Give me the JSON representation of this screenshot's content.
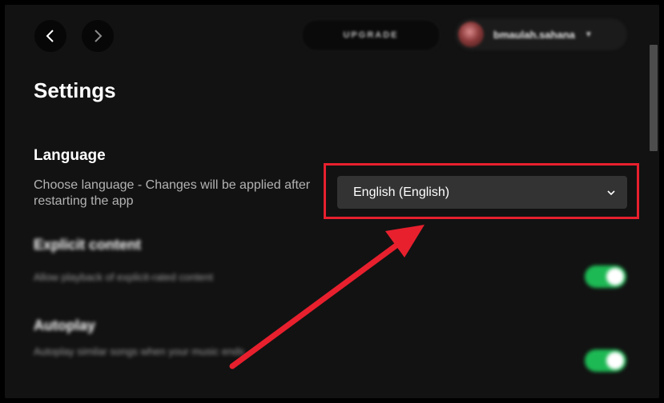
{
  "navigation": {
    "back_icon": "chevron-left-icon",
    "forward_icon": "chevron-right-icon"
  },
  "header": {
    "upgrade_label": "UPGRADE",
    "user_name": "bmaulah.sahana",
    "user_caret": "▼"
  },
  "page": {
    "title": "Settings"
  },
  "language": {
    "title": "Language",
    "description": "Choose language - Changes will be applied after restarting the app",
    "selected_value": "English (English)"
  },
  "explicit_content": {
    "title": "Explicit content",
    "description": "Allow playback of explicit-rated content",
    "enabled": true
  },
  "autoplay": {
    "title": "Autoplay",
    "description": "Autoplay similar songs when your music ends",
    "enabled": true
  },
  "colors": {
    "background": "#121212",
    "accent_green": "#1db954",
    "annotation_red": "#e8202e"
  }
}
